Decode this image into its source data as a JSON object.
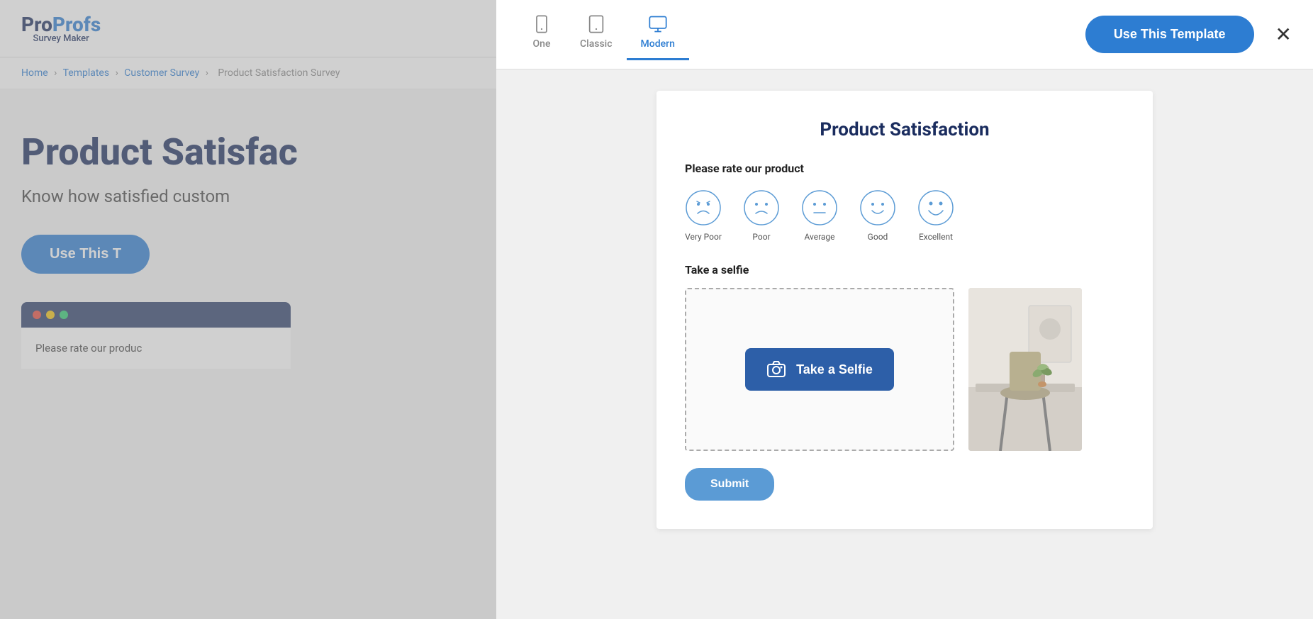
{
  "brand": {
    "pro": "Pro",
    "profs": "Profs",
    "tagline": "Survey Maker"
  },
  "breadcrumb": {
    "home": "Home",
    "templates": "Templates",
    "customer_survey": "Customer Survey",
    "current": "Product Satisfaction Survey"
  },
  "bg_page": {
    "title": "Product Satisfac",
    "subtitle": "Know how satisfied custom",
    "use_this_label": "Use This T",
    "browser_content": "Please rate our produc"
  },
  "modal": {
    "close_icon": "✕",
    "use_template_btn": "Use This Template",
    "device_tabs": [
      {
        "id": "one",
        "label": "One",
        "active": false
      },
      {
        "id": "classic",
        "label": "Classic",
        "active": false
      },
      {
        "id": "modern",
        "label": "Modern",
        "active": true
      }
    ],
    "survey": {
      "title": "Product Satisfaction",
      "question1": {
        "label": "Please rate our product",
        "options": [
          {
            "label": "Very Poor",
            "mood": "very-poor"
          },
          {
            "label": "Poor",
            "mood": "poor"
          },
          {
            "label": "Average",
            "mood": "average"
          },
          {
            "label": "Good",
            "mood": "good"
          },
          {
            "label": "Excellent",
            "mood": "excellent"
          }
        ]
      },
      "question2": {
        "label": "Take a selfie"
      },
      "selfie_btn": "Take a Selfie",
      "submit_btn": "Submit"
    }
  }
}
